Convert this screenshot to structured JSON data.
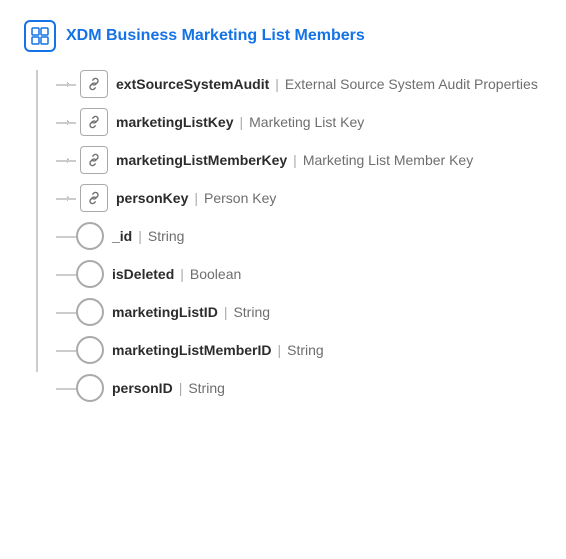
{
  "root": {
    "icon": "schema-icon",
    "title": "XDM Business Marketing List Members"
  },
  "rows": [
    {
      "id": "extSourceSystemAudit",
      "type": "object",
      "hasExpand": true,
      "name": "extSourceSystemAudit",
      "divider": "|",
      "desc": "External Source System Audit Properties"
    },
    {
      "id": "marketingListKey",
      "type": "object",
      "hasExpand": true,
      "name": "marketingListKey",
      "divider": "|",
      "desc": "Marketing List Key"
    },
    {
      "id": "marketingListMemberKey",
      "type": "object",
      "hasExpand": true,
      "name": "marketingListMemberKey",
      "divider": "|",
      "desc": "Marketing List Member Key"
    },
    {
      "id": "personKey",
      "type": "object",
      "hasExpand": true,
      "name": "personKey",
      "divider": "|",
      "desc": "Person Key"
    },
    {
      "id": "_id",
      "type": "primitive",
      "hasExpand": false,
      "name": "_id",
      "divider": "|",
      "desc": "String"
    },
    {
      "id": "isDeleted",
      "type": "primitive",
      "hasExpand": false,
      "name": "isDeleted",
      "divider": "|",
      "desc": "Boolean"
    },
    {
      "id": "marketingListID",
      "type": "primitive",
      "hasExpand": false,
      "name": "marketingListID",
      "divider": "|",
      "desc": "String"
    },
    {
      "id": "marketingListMemberID",
      "type": "primitive",
      "hasExpand": false,
      "name": "marketingListMemberID",
      "divider": "|",
      "desc": "String"
    },
    {
      "id": "personID",
      "type": "primitive",
      "hasExpand": false,
      "name": "personID",
      "divider": "|",
      "desc": "String"
    }
  ],
  "icons": {
    "expand": "›",
    "link": "🔗",
    "schema": "⊞"
  }
}
